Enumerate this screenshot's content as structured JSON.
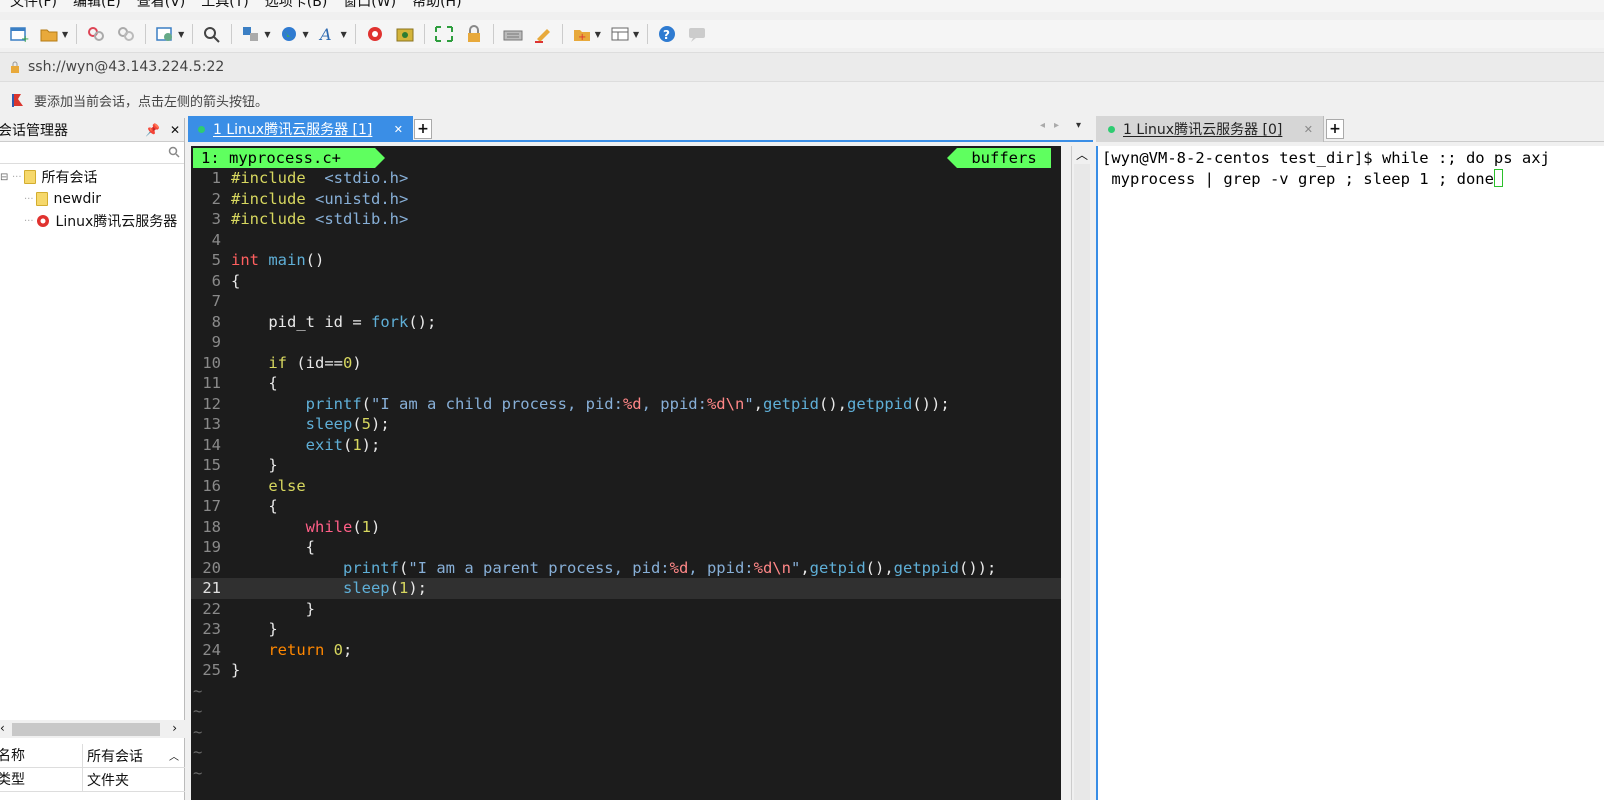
{
  "menu": [
    "文件(F)",
    "编辑(E)",
    "查看(V)",
    "工具(T)",
    "选项卡(B)",
    "窗口(W)",
    "帮助(H)"
  ],
  "toolbar_icons": [
    "new-session-icon",
    "open-folder-icon",
    "reconnect-icon",
    "disconnect-icon",
    "session-properties-icon",
    "find-icon",
    "transfer-icon",
    "globe-icon",
    "font-icon",
    "xftp-icon",
    "xshell-icon",
    "fullscreen-icon",
    "lock-icon",
    "keyboard-icon",
    "highlight-icon",
    "add-tab-icon",
    "layout-icon",
    "help-icon",
    "chat-icon"
  ],
  "address": {
    "url": "ssh://wyn@43.143.224.5:22"
  },
  "hint": {
    "text": "要添加当前会话，点击左侧的箭头按钮。"
  },
  "session_panel": {
    "title": "会话管理器",
    "tree": {
      "root": "所有会话",
      "children": [
        "newdir",
        "Linux腾讯云服务器"
      ]
    },
    "properties": {
      "header": [
        "名称",
        "所有会话"
      ],
      "rows": [
        [
          "类型",
          "文件夹"
        ]
      ]
    }
  },
  "left_tab": {
    "label": "1 Linux腾讯云服务器 [1]",
    "add": "+"
  },
  "right_tab": {
    "label": "1 Linux腾讯云服务器 [0]",
    "add": "+"
  },
  "editor": {
    "file_badge": "1: myprocess.c+",
    "buffers_badge": "buffers",
    "current_line": 21,
    "lines": [
      "#include  <stdio.h>",
      "#include <unistd.h>",
      "#include <stdlib.h>",
      "",
      "int main()",
      "{",
      "",
      "    pid_t id = fork();",
      "",
      "    if (id==0)",
      "    {",
      "        printf(\"I am a child process, pid:%d, ppid:%d\\n\",getpid(),getppid());",
      "        sleep(5);",
      "        exit(1);",
      "    }",
      "    else",
      "    {",
      "        while(1)",
      "        {",
      "            printf(\"I am a parent process, pid:%d, ppid:%d\\n\",getpid(),getppid());",
      "            sleep(1);",
      "        }",
      "    }",
      "    return 0;",
      "}"
    ],
    "tildes": 5
  },
  "terminal": {
    "lines": [
      "[wyn@VM-8-2-centos test_dir]$ while :; do ps axj",
      " myprocess | grep -v grep ; sleep 1 ; done"
    ]
  },
  "colors": {
    "accent": "#3a8ee6",
    "editor_bg": "#1c1c1c",
    "badge_green": "#5fff5f",
    "cursor_green": "#2bc02b"
  }
}
